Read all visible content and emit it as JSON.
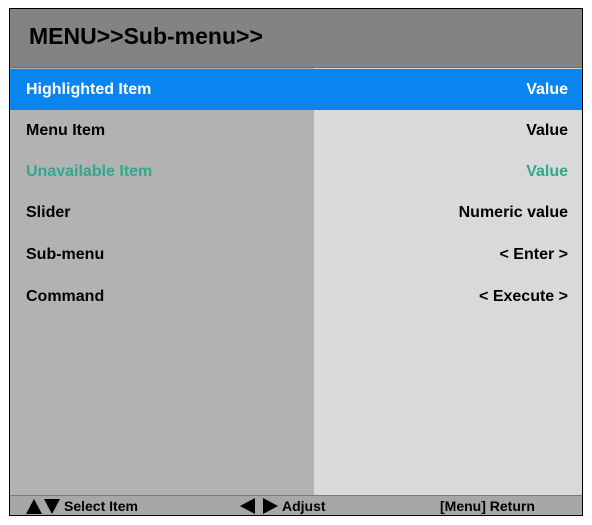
{
  "title": "MENU>>Sub-menu>>",
  "rows": [
    {
      "label": "Highlighted Item",
      "value": "Value",
      "state": "highlighted"
    },
    {
      "label": "Menu Item",
      "value": "Value",
      "state": "normal"
    },
    {
      "label": "Unavailable Item",
      "value": "Value",
      "state": "unavailable"
    },
    {
      "label": "Slider",
      "value": "Numeric value",
      "state": "normal"
    },
    {
      "label": "Sub-menu",
      "value": "< Enter >",
      "state": "normal"
    },
    {
      "label": "Command",
      "value": "< Execute >",
      "state": "normal"
    }
  ],
  "footer": {
    "select_label": "Select Item",
    "select_icon": "up-down-triangle-icon",
    "adjust_label": "Adjust",
    "adjust_icon": "left-right-triangle-icon",
    "return_label": "[Menu] Return"
  },
  "colors": {
    "title_bar": "#838383",
    "highlight": "#0a85f0",
    "unavailable_text": "#2fa98a",
    "label_column": "#b2b2b2",
    "value_column": "#d9d9d9"
  }
}
